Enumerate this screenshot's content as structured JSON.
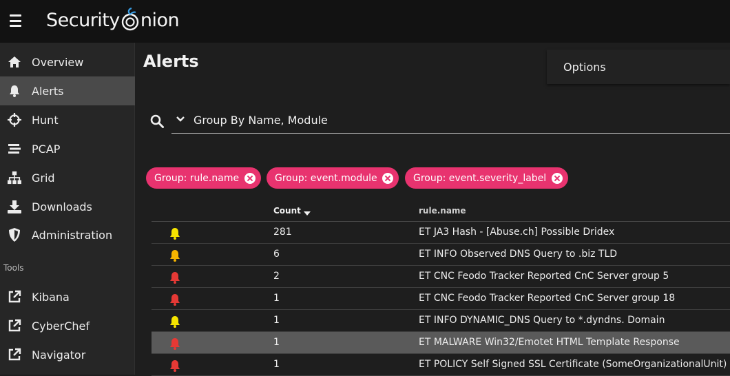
{
  "app": {
    "logo_text_left": "Security",
    "logo_text_right": "nion"
  },
  "sidebar": {
    "items": [
      {
        "label": "Overview",
        "icon": "home-icon"
      },
      {
        "label": "Alerts",
        "icon": "bell-icon",
        "active": true
      },
      {
        "label": "Hunt",
        "icon": "crosshairs-icon"
      },
      {
        "label": "PCAP",
        "icon": "stream-icon"
      },
      {
        "label": "Grid",
        "icon": "sitemap-icon"
      },
      {
        "label": "Downloads",
        "icon": "download-icon"
      },
      {
        "label": "Administration",
        "icon": "shield-icon"
      }
    ],
    "tools_label": "Tools",
    "tools": [
      {
        "label": "Kibana",
        "icon": "external-link-icon"
      },
      {
        "label": "CyberChef",
        "icon": "external-link-icon"
      },
      {
        "label": "Navigator",
        "icon": "external-link-icon"
      }
    ]
  },
  "main": {
    "title": "Alerts",
    "options_label": "Options",
    "query": "Group By Name, Module",
    "chips": [
      "Group: rule.name",
      "Group: event.module",
      "Group: event.severity_label"
    ],
    "columns": {
      "count": "Count",
      "rule": "rule.name"
    },
    "rows": [
      {
        "count": "281",
        "rule": "ET JA3 Hash - [Abuse.ch] Possible Dridex",
        "severity": "low"
      },
      {
        "count": "6",
        "rule": "ET INFO Observed DNS Query to .biz TLD",
        "severity": "medium"
      },
      {
        "count": "2",
        "rule": "ET CNC Feodo Tracker Reported CnC Server group 5",
        "severity": "high"
      },
      {
        "count": "1",
        "rule": "ET CNC Feodo Tracker Reported CnC Server group 18",
        "severity": "high"
      },
      {
        "count": "1",
        "rule": "ET INFO DYNAMIC_DNS Query to *.dyndns. Domain",
        "severity": "low"
      },
      {
        "count": "1",
        "rule": "ET MALWARE Win32/Emotet HTML Template Response",
        "severity": "high"
      },
      {
        "count": "1",
        "rule": "ET POLICY Self Signed SSL Certificate (SomeOrganizationalUnit)",
        "severity": "high"
      }
    ]
  },
  "colors": {
    "chip": "#e8336f",
    "low": "#f5e400",
    "medium": "#f5b400",
    "high": "#e53935",
    "active_nav": "#4a4a4a"
  }
}
